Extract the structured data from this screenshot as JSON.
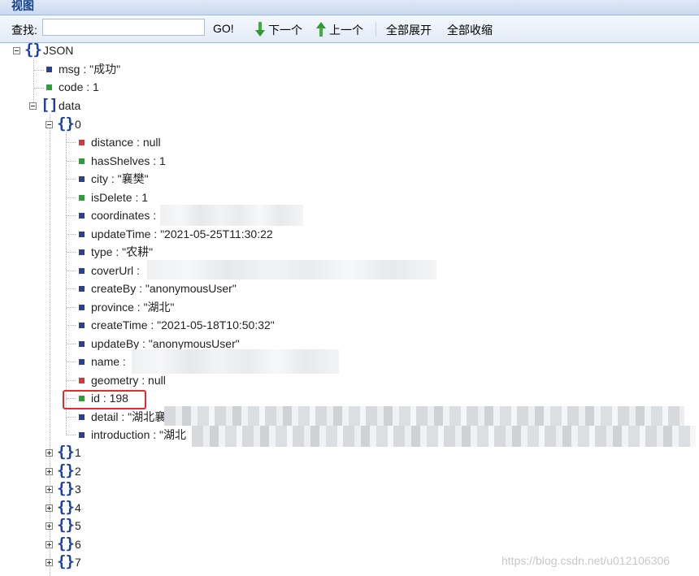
{
  "header": {
    "title": "视图"
  },
  "toolbar": {
    "find_label": "查找:",
    "find_value": "",
    "go_label": "GO!",
    "next_label": "下一个",
    "prev_label": "上一个",
    "expand_all_label": "全部展开",
    "collapse_all_label": "全部收缩"
  },
  "tree": {
    "root_label": "JSON",
    "msg": "msg : \"成功\"",
    "code": "code : 1",
    "data_label": "data",
    "item0_label": "0",
    "fields": [
      "distance : null",
      "hasShelves : 1",
      "city : \"襄樊\"",
      "isDelete : 1",
      "coordinates : ",
      "updateTime : \"2021-05-25T11:30:22",
      "type : \"农耕\"",
      "coverUrl : ",
      "createBy : \"anonymousUser\"",
      "province : \"湖北\"",
      "createTime : \"2021-05-18T10:50:32\"",
      "updateBy : \"anonymousUser\"",
      "name : ",
      "geometry : null",
      "id : 198",
      "detail : \"湖北襄",
      "introduction : \"湖北"
    ],
    "collapsed_items": [
      "1",
      "2",
      "3",
      "4",
      "5",
      "6",
      "7"
    ]
  },
  "watermark": "https://blog.csdn.net/u012106306",
  "colors": {
    "string_marker": "#2e3f8f",
    "number_marker": "#2f9e3a",
    "null_marker": "#d03a3a",
    "highlight_box": "#e52b2b"
  }
}
